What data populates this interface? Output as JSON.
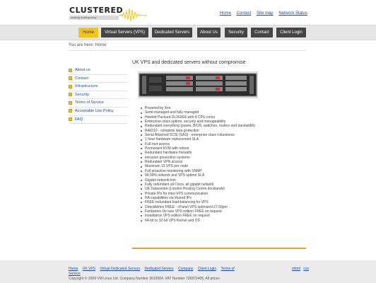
{
  "header": {
    "logo_text": "CLUSTERED",
    "logo_tagline": "making hosting easy",
    "top_links": [
      "Home",
      "Contact",
      "Site map",
      "Network Status"
    ]
  },
  "nav": {
    "items": [
      "Home",
      "Virtual Servers (VPS)",
      "Dedicated Servers",
      "About Us",
      "Security",
      "Contact",
      "Client Login"
    ],
    "active_index": 0
  },
  "breadcrumb": "You are here: Home",
  "sidebar": {
    "items": [
      "About us",
      "Contact",
      "Infrastructure",
      "Security",
      "Terms of Service",
      "Acceptable Use Policy",
      "FAQ"
    ]
  },
  "main": {
    "title": "UK VPS and dedicated servers without compromise",
    "features": [
      "Powered by Xen",
      "Semi-managed and fully managed",
      "Hewlett Packard DL360G6 with 8 CPU cores",
      "Enterprise-class uptime, security and manageability",
      "Redundant everything (power, BIOS, switches, routers and bandwidth)",
      "RAID10 - complete data protection",
      "Serial Attached SCSI (SAS) - enterprise class robustness",
      "1 hour hardware replacement SLA",
      "Full root access",
      "Permanent KVM with reboot",
      "Redundant hardware firewalls",
      "Intrusion prevention systems",
      "Redundant VPN access",
      "Maximum 15 VPS per node",
      "Full proactive monitoring with SNMP",
      "99.99% network and VPS uptime SLA",
      "Gigabit network link",
      "Fully redundant all Cisco, all gigabit network",
      "UK Datacentre (London Hosting Centre docklands)",
      "Private IPs for inter-VPS communication",
      "HA capabilities via shared IPs",
      "FREE redundant load-balancing for VPS",
      "DirectAdmin FREE - cPanel VPS optimized £7.50pm",
      "Fantastico De luxe VPS edition FREE on request",
      "Installatron VPS edition FREE on request",
      "64-bit or 32-bit VPS Kernel and OS"
    ]
  },
  "footer": {
    "links": [
      "Home",
      "UK VPS",
      "Virtual Dedicated Servers",
      "Dedicated Servers",
      "Company",
      "Client Login",
      "Terms of Service"
    ],
    "right_links": [
      "shtml",
      "css"
    ],
    "copyright": "Copyright © 2009 VM Linux Ltd. Company Number 3615064. VAT Number 726872406. All prices"
  },
  "colors": {
    "accent_yellow": "#f3c516",
    "nav_dark": "#444444",
    "link_blue": "#1f4ea8",
    "rule_orange": "#f0a020"
  }
}
